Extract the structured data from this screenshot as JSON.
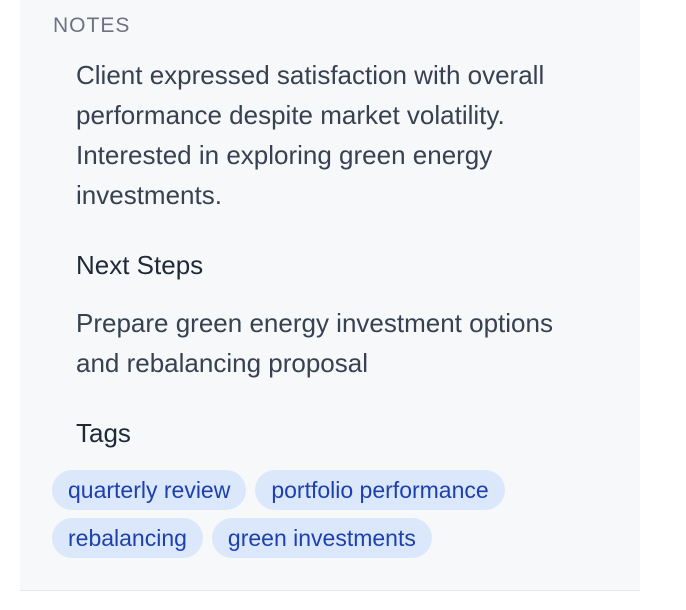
{
  "notes": {
    "label": "NOTES",
    "text": "Client expressed satisfaction with overall performance despite market volatility. Interested in exploring green energy investments."
  },
  "next_steps": {
    "heading": "Next Steps",
    "text": "Prepare green energy investment options and rebalancing proposal"
  },
  "tags": {
    "heading": "Tags",
    "items": [
      "quarterly review",
      "portfolio performance",
      "rebalancing",
      "green investments"
    ]
  },
  "colors": {
    "tag_background": "#dbe7fb",
    "tag_text": "#1e40af",
    "panel_background": "#f7f8fa"
  }
}
